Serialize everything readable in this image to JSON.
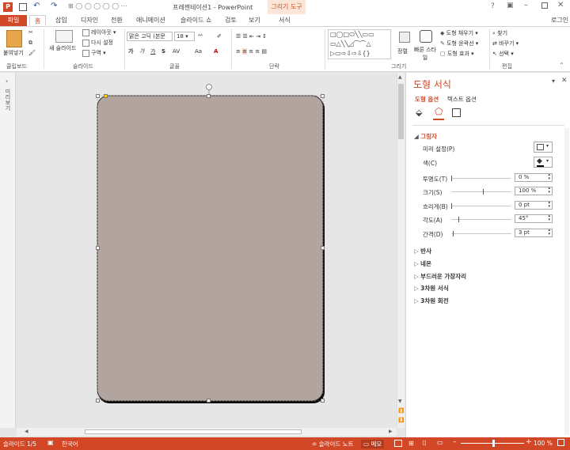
{
  "titlebar": {
    "title": "프레젠테이션1 - PowerPoint",
    "context_tab_group": "그리기 도구",
    "signin": "로그인"
  },
  "tabs": [
    "파일",
    "홈",
    "삽입",
    "디자인",
    "전환",
    "애니메이션",
    "슬라이드 쇼",
    "검토",
    "보기",
    "서식"
  ],
  "ribbon": {
    "clipboard": {
      "paste": "붙여넣기",
      "label": "클립보드"
    },
    "slides": {
      "new_slide": "새 슬라이드",
      "layout": "레이아웃",
      "reset": "다시 설정",
      "section": "구역",
      "label": "슬라이드"
    },
    "font": {
      "font_name": "맑은 고딕 (본문",
      "font_size": "18",
      "label": "글꼴",
      "bold": "가",
      "italic": "가",
      "underline": "가",
      "strike": "S",
      "case": "Aa"
    },
    "paragraph": {
      "label": "단락"
    },
    "drawing": {
      "label": "그리기",
      "arrange": "정렬",
      "quick_styles": "빠른 스타일",
      "fill": "도형 채우기",
      "outline": "도형 윤곽선",
      "effects": "도형 효과"
    },
    "editing": {
      "label": "편집",
      "find": "찾기",
      "replace": "바꾸기",
      "select": "선택"
    }
  },
  "leftstrip": {
    "label": "미리보기"
  },
  "pane": {
    "title": "도형 서식",
    "tab_shape": "도형 옵션",
    "tab_text": "텍스트 옵션",
    "section_shadow": "그림자",
    "rows": [
      {
        "label": "미리 설정(P)",
        "value": ""
      },
      {
        "label": "색(C)",
        "value": ""
      },
      {
        "label": "투명도(T)",
        "value": "0 %",
        "level": 0
      },
      {
        "label": "크기(S)",
        "value": "100 %",
        "level": 0.52
      },
      {
        "label": "흐리게(B)",
        "value": "0 pt",
        "level": 0
      },
      {
        "label": "각도(A)",
        "value": "45°",
        "level": 0.12
      },
      {
        "label": "간격(D)",
        "value": "3 pt",
        "level": 0.02
      }
    ],
    "collapsed_sections": [
      "반사",
      "네온",
      "부드러운 가장자리",
      "3차원 서식",
      "3차원 회전"
    ]
  },
  "slide": {
    "shape_fill": "#b2a49e"
  },
  "statusbar": {
    "slide_info": "슬라이드 1/5",
    "language": "한국어",
    "notes": "슬라이드 노트",
    "memo": "메모",
    "zoom": "100 %"
  },
  "colors": {
    "accent": "#d24726"
  }
}
